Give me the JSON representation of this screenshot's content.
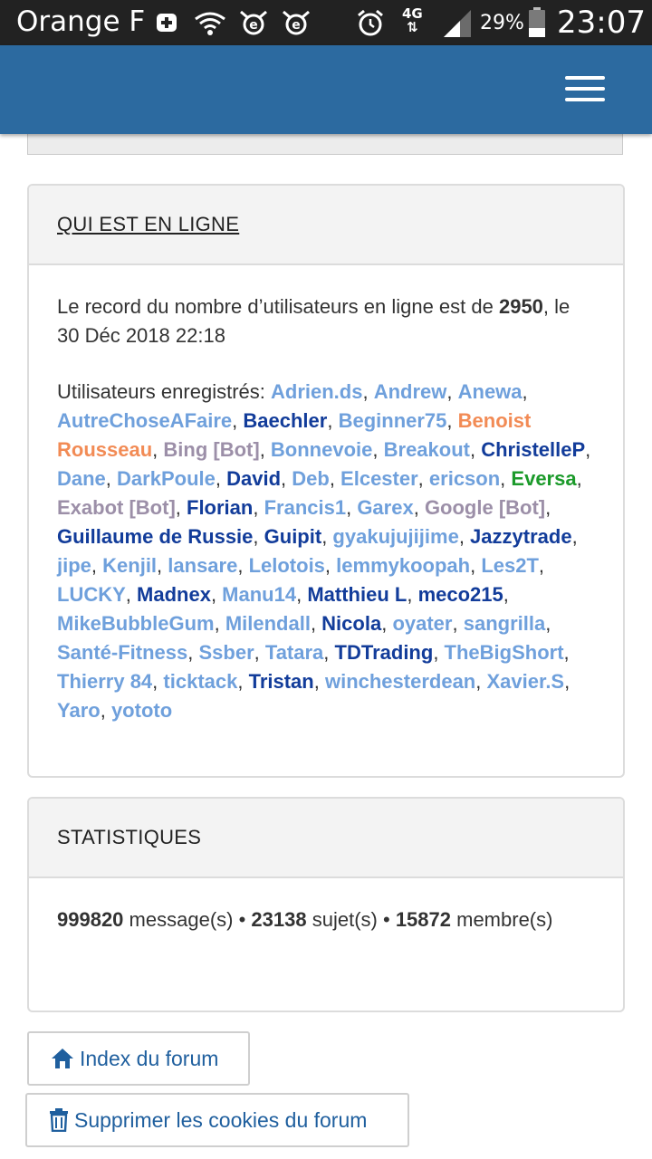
{
  "status_bar": {
    "carrier": "Orange F",
    "network": "4G",
    "battery": "29%",
    "time": "23:07"
  },
  "header": {
    "menu_icon": "hamburger-menu-icon"
  },
  "who_online": {
    "title": "QUI EST EN LIGNE",
    "record_prefix": "Le record du nombre d’utilisateurs en ligne est de",
    "record_count": "2950",
    "record_date": "le 30 Déc 2018 22:18",
    "registered_label": "Utilisateurs enregistrés:",
    "users": [
      {
        "name": "Adrien.ds",
        "style": "reg"
      },
      {
        "name": "Andrew",
        "style": "reg"
      },
      {
        "name": "Anewa",
        "style": "reg"
      },
      {
        "name": "AutreChoseAFaire",
        "style": "reg"
      },
      {
        "name": "Baechler",
        "style": "dark"
      },
      {
        "name": "Beginner75",
        "style": "reg"
      },
      {
        "name": "Benoist Rousseau",
        "style": "orange"
      },
      {
        "name": "Bing [Bot]",
        "style": "bot"
      },
      {
        "name": "Bonnevoie",
        "style": "reg"
      },
      {
        "name": "Breakout",
        "style": "reg"
      },
      {
        "name": "ChristelleP",
        "style": "dark"
      },
      {
        "name": "Dane",
        "style": "reg"
      },
      {
        "name": "DarkPoule",
        "style": "reg"
      },
      {
        "name": "David",
        "style": "dark"
      },
      {
        "name": "Deb",
        "style": "reg"
      },
      {
        "name": "Elcester",
        "style": "reg"
      },
      {
        "name": "ericson",
        "style": "reg"
      },
      {
        "name": "Eversa",
        "style": "green"
      },
      {
        "name": "Exabot [Bot]",
        "style": "bot"
      },
      {
        "name": "Florian",
        "style": "dark"
      },
      {
        "name": "Francis1",
        "style": "reg"
      },
      {
        "name": "Garex",
        "style": "reg"
      },
      {
        "name": "Google [Bot]",
        "style": "bot"
      },
      {
        "name": "Guillaume de Russie",
        "style": "dark"
      },
      {
        "name": "Guipit",
        "style": "dark"
      },
      {
        "name": "gyakujujijime",
        "style": "reg"
      },
      {
        "name": "Jazzytrade",
        "style": "dark"
      },
      {
        "name": "jipe",
        "style": "reg"
      },
      {
        "name": "Kenjil",
        "style": "reg"
      },
      {
        "name": "lansare",
        "style": "reg"
      },
      {
        "name": "Lelotois",
        "style": "reg"
      },
      {
        "name": "lemmykoopah",
        "style": "reg"
      },
      {
        "name": "Les2T",
        "style": "reg"
      },
      {
        "name": "LUCKY",
        "style": "reg"
      },
      {
        "name": "Madnex",
        "style": "dark"
      },
      {
        "name": "Manu14",
        "style": "reg"
      },
      {
        "name": "Matthieu L",
        "style": "dark"
      },
      {
        "name": "meco215",
        "style": "dark"
      },
      {
        "name": "MikeBubbleGum",
        "style": "reg"
      },
      {
        "name": "Milendall",
        "style": "reg"
      },
      {
        "name": "Nicola",
        "style": "dark"
      },
      {
        "name": "oyater",
        "style": "reg"
      },
      {
        "name": "sangrilla",
        "style": "reg"
      },
      {
        "name": "Santé-Fitness",
        "style": "reg"
      },
      {
        "name": "Ssber",
        "style": "reg"
      },
      {
        "name": "Tatara",
        "style": "reg"
      },
      {
        "name": "TDTrading",
        "style": "dark"
      },
      {
        "name": "TheBigShort",
        "style": "reg"
      },
      {
        "name": "Thierry 84",
        "style": "reg"
      },
      {
        "name": "ticktack",
        "style": "reg"
      },
      {
        "name": "Tristan",
        "style": "dark"
      },
      {
        "name": "winchesterdean",
        "style": "reg"
      },
      {
        "name": "Xavier.S",
        "style": "reg"
      },
      {
        "name": "Yaro",
        "style": "reg"
      },
      {
        "name": "yototo",
        "style": "reg"
      }
    ]
  },
  "statistics": {
    "title": "STATISTIQUES",
    "messages_count": "999820",
    "messages_label": "message(s)",
    "topics_count": "23138",
    "topics_label": "sujet(s)",
    "members_count": "15872",
    "members_label": "membre(s)",
    "separator": "•"
  },
  "footer": {
    "index_label": "Index du forum",
    "index_icon": "home-icon",
    "cookies_label": "Supprimer les cookies du forum",
    "cookies_icon": "trash-icon"
  },
  "colors": {
    "header_bg": "#2c6aa0",
    "link": "#6fa0dc",
    "link_dark": "#123c9a",
    "bot": "#9c8fa8",
    "orange": "#f28b55",
    "green": "#1b9a2a"
  }
}
